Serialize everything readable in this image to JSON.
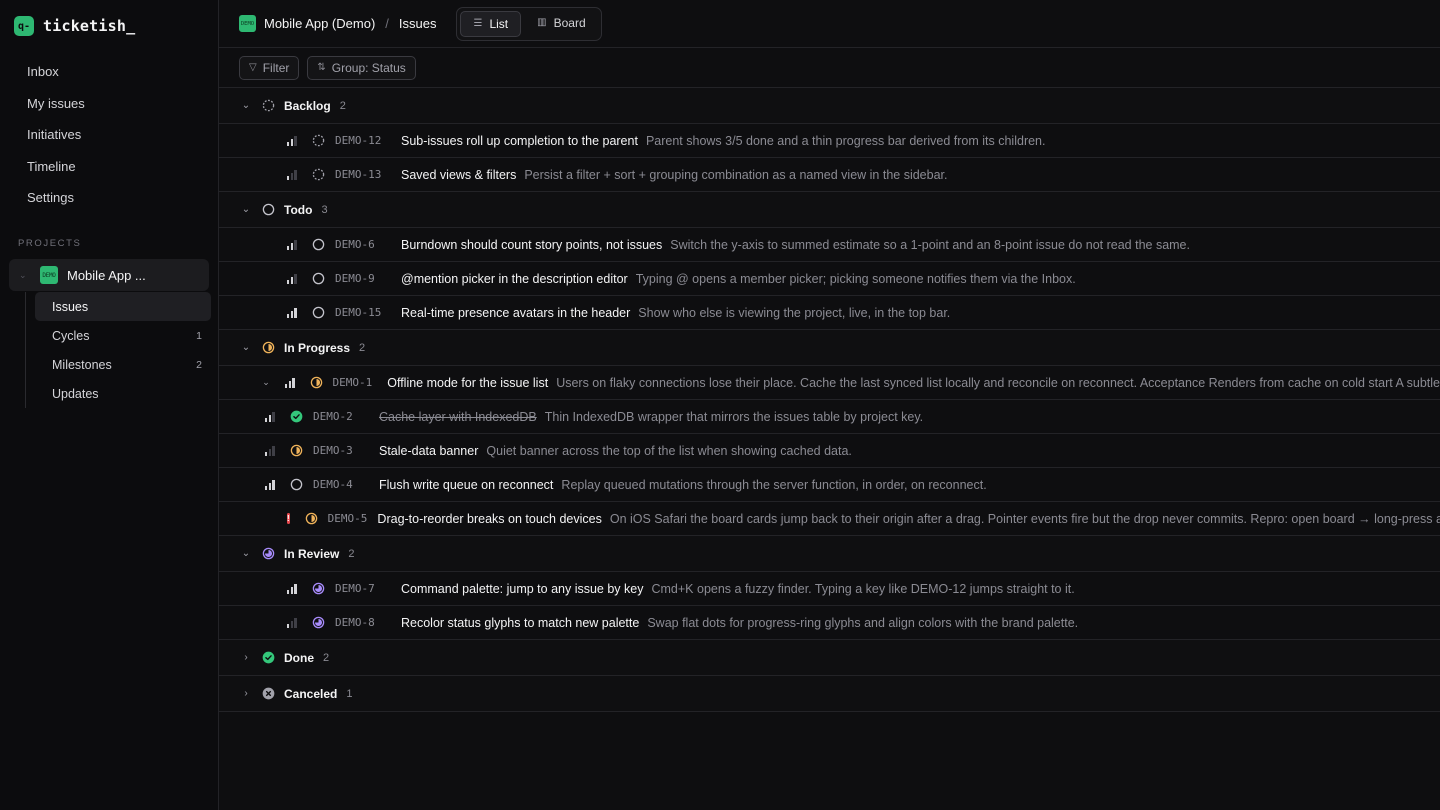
{
  "brand": {
    "logo": "q-",
    "name": "ticketish_"
  },
  "sidebar": {
    "nav": [
      "Inbox",
      "My issues",
      "Initiatives",
      "Timeline",
      "Settings"
    ],
    "projects_label": "PROJECTS",
    "project": {
      "icon_text": "DEMO",
      "name": "Mobile App ..."
    },
    "subnav": [
      {
        "label": "Issues",
        "count": ""
      },
      {
        "label": "Cycles",
        "count": "1"
      },
      {
        "label": "Milestones",
        "count": "2"
      },
      {
        "label": "Updates",
        "count": ""
      }
    ]
  },
  "header": {
    "project_icon": "DEMO",
    "project_name": "Mobile App (Demo)",
    "separator": "/",
    "page": "Issues",
    "views": {
      "list": "List",
      "board": "Board"
    }
  },
  "toolbar": {
    "filter": "Filter",
    "group": "Group: Status"
  },
  "colors": {
    "accent": "#2eb872",
    "in_progress": "#f0b35a",
    "in_review": "#a78bfa",
    "done": "#34c77b",
    "urgent": "#e5484d"
  },
  "groups": [
    {
      "name": "Backlog",
      "count": "2",
      "status": "backlog",
      "expanded": true,
      "issues": [
        {
          "id": "DEMO-12",
          "priority": 2,
          "status": "backlog",
          "title": "Sub-issues roll up completion to the parent",
          "desc": "Parent shows 3/5 done and a thin progress bar derived from its children."
        },
        {
          "id": "DEMO-13",
          "priority": 1,
          "status": "backlog",
          "title": "Saved views & filters",
          "desc": "Persist a filter + sort + grouping combination as a named view in the sidebar."
        }
      ]
    },
    {
      "name": "Todo",
      "count": "3",
      "status": "todo",
      "expanded": true,
      "issues": [
        {
          "id": "DEMO-6",
          "priority": 2,
          "status": "todo",
          "title": "Burndown should count story points, not issues",
          "desc": "Switch the y-axis to summed estimate so a 1-point and an 8-point issue do not read the same."
        },
        {
          "id": "DEMO-9",
          "priority": 2,
          "status": "todo",
          "title": "@mention picker in the description editor",
          "desc": "Typing @ opens a member picker; picking someone notifies them via the Inbox."
        },
        {
          "id": "DEMO-15",
          "priority": 3,
          "status": "todo",
          "title": "Real-time presence avatars in the header",
          "desc": "Show who else is viewing the project, live, in the top bar."
        }
      ]
    },
    {
      "name": "In Progress",
      "count": "2",
      "status": "in_progress",
      "expanded": true,
      "issues": [
        {
          "id": "DEMO-1",
          "priority": 3,
          "status": "in_progress",
          "has_children": true,
          "title": "Offline mode for the issue list",
          "desc": "Users on flaky connections lose their place. Cache the last synced list locally and reconcile on reconnect. Acceptance Renders from cache on cold start A subtle",
          "children": [
            {
              "id": "DEMO-2",
              "priority": 2,
              "status": "done",
              "struck": true,
              "title": "Cache layer with IndexedDB",
              "desc": "Thin IndexedDB wrapper that mirrors the issues table by project key."
            },
            {
              "id": "DEMO-3",
              "priority": 1,
              "status": "in_progress",
              "title": "Stale-data banner",
              "desc": "Quiet banner across the top of the list when showing cached data."
            },
            {
              "id": "DEMO-4",
              "priority": 3,
              "status": "todo",
              "title": "Flush write queue on reconnect",
              "desc": "Replay queued mutations through the server function, in order, on reconnect."
            }
          ]
        },
        {
          "id": "DEMO-5",
          "priority": "urgent",
          "status": "in_progress",
          "title": "Drag-to-reorder breaks on touch devices",
          "desc": "On iOS Safari the board cards jump back to their origin after a drag. Pointer events fire but the drop never commits. Repro: open board → long-press a"
        }
      ]
    },
    {
      "name": "In Review",
      "count": "2",
      "status": "in_review",
      "expanded": true,
      "issues": [
        {
          "id": "DEMO-7",
          "priority": 3,
          "status": "in_review",
          "title": "Command palette: jump to any issue by key",
          "desc": "Cmd+K opens a fuzzy finder. Typing a key like DEMO-12 jumps straight to it."
        },
        {
          "id": "DEMO-8",
          "priority": 1,
          "status": "in_review",
          "title": "Recolor status glyphs to match new palette",
          "desc": "Swap flat dots for progress-ring glyphs and align colors with the brand palette."
        }
      ]
    },
    {
      "name": "Done",
      "count": "2",
      "status": "done",
      "expanded": false,
      "issues": []
    },
    {
      "name": "Canceled",
      "count": "1",
      "status": "canceled",
      "expanded": false,
      "issues": []
    }
  ]
}
